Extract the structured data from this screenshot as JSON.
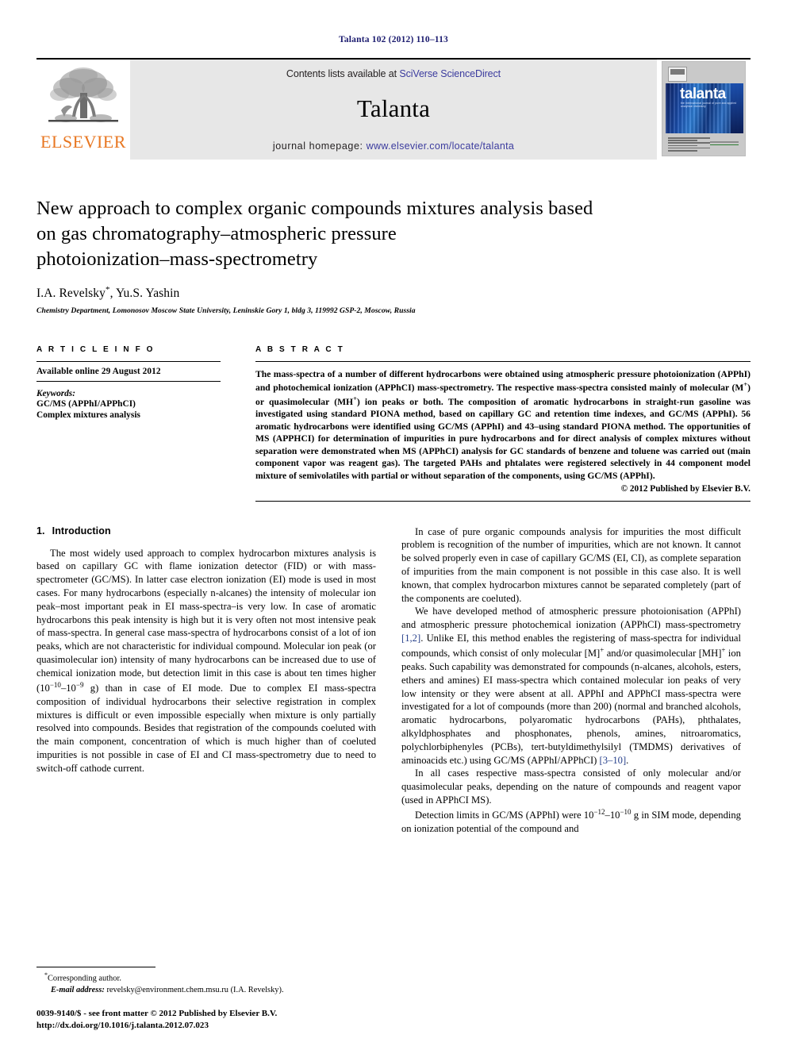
{
  "running_head": "Talanta 102 (2012) 110–113",
  "masthead": {
    "publisher_logo_label": "ELSEVIER",
    "contents_prefix": "Contents lists available at ",
    "contents_link": "SciVerse ScienceDirect",
    "journal_title": "Talanta",
    "homepage_prefix": "journal homepage: ",
    "homepage_link": "www.elsevier.com/locate/talanta",
    "cover_title": "talanta",
    "cover_subtitle": "the international journal of pure and applied analytical chemistry"
  },
  "article": {
    "title_line1": "New approach to complex organic compounds mixtures analysis based",
    "title_line2": "on gas chromatography–atmospheric pressure",
    "title_line3": "photoionization–mass-spectrometry",
    "authors": "I.A. Revelsky",
    "authors_star": "*",
    "authors_rest": ", Yu.S. Yashin",
    "affiliation": "Chemistry Department, Lomonosov Moscow State University, Leninskie Gory 1, bldg 3, 119992 GSP-2, Moscow, Russia"
  },
  "article_info": {
    "heading": "A R T I C L E  I N F O",
    "history": "Available online 29 August 2012",
    "keywords_label": "Keywords:",
    "keywords": [
      "GC/MS (APPhI/APPhCI)",
      "Complex mixtures analysis"
    ]
  },
  "abstract": {
    "heading": "A B S T R A C T",
    "p1_a": "The mass-spectra of a number of different hydrocarbons were obtained using atmospheric pressure photoionization (APPhI) and photochemical ionization (APPhCI) mass-spectrometry. The respective mass-spectra consisted mainly of molecular (M",
    "p1_sup1": "+",
    "p1_b": ") or quasimolecular (MH",
    "p1_sup2": "+",
    "p1_c": ") ion peaks or both. The composition of aromatic hydrocarbons in straight-run gasoline was investigated using standard PIONA method, based on capillary GC and retention time indexes, and GC/MS (APPhI). 56 aromatic hydrocarbons were identified using GC/MS (APPhI) and 43–using standard PIONA method. The opportunities of MS (APPHCI) for determination of impurities in pure hydrocarbons and for direct analysis of complex mixtures without separation were demonstrated when MS (APPhCI) analysis for GC standards of benzene and toluene was carried out (main component vapor was reagent gas). The targeted PAHs and phtalates were registered selectively in 44 component model mixture of semivolatiles with partial or without separation of the components, using GC/MS (APPhI).",
    "copyright": "© 2012 Published by Elsevier B.V."
  },
  "body": {
    "section1_number": "1.",
    "section1_title": "Introduction",
    "left_p1_a": "The most widely used approach to complex hydrocarbon mixtures analysis is based on capillary GC with flame ionization detector (FID) or with mass-spectrometer (GC/MS). In latter case electron ionization (EI) mode is used in most cases. For many hydrocarbons (especially n-alcanes) the intensity of molecular ion peak–most important peak in EI mass-spectra–is very low. In case of aromatic hydrocarbons this peak intensity is high but it is very often not most intensive peak of mass-spectra. In general case mass-spectra of hydrocarbons consist of a lot of ion peaks, which are not characteristic for individual compound. Molecular ion peak (or quasimolecular ion) intensity of many hydrocarbons can be increased due to use of chemical ionization mode, but detection limit in this case is about ten times higher (10",
    "left_p1_sup1": "−10",
    "left_p1_b": "–10",
    "left_p1_sup2": "−9",
    "left_p1_c": " g) than in case of EI mode. Due to complex EI mass-spectra composition of individual hydrocarbons their selective registration in complex mixtures is difficult or even impossible especially when mixture is only partially resolved into compounds. Besides that registration of the compounds coeluted with the main component, concentration of which is much higher than of coeluted impurities is not possible in case of EI and CI mass-spectrometry due to need to switch-off cathode current.",
    "right_p1": "In case of pure organic compounds analysis for impurities the most difficult problem is recognition of the number of impurities, which are not known. It cannot be solved properly even in case of capillary GC/MS (EI, CI), as complete separation of impurities from the main component is not possible in this case also. It is well known, that complex hydrocarbon mixtures cannot be separated completely (part of the components are coeluted).",
    "right_p2_a": "We have developed method of atmospheric pressure photoionisation (APPhI) and atmospheric pressure photochemical ionization (APPhCI) mass-spectrometry ",
    "right_p2_cite1": "[1,2]",
    "right_p2_b": ". Unlike EI, this method enables the registering of mass-spectra for individual compounds, which consist of only molecular [M]",
    "right_p2_sup1": "+",
    "right_p2_c": " and/or quasimolecular [MH]",
    "right_p2_sup2": "+",
    "right_p2_d": " ion peaks. Such capability was demonstrated for compounds (n-alcanes, alcohols, esters, ethers and amines) EI mass-spectra which contained molecular ion peaks of very low intensity or they were absent at all. APPhI and APPhCI mass-spectra were investigated for a lot of compounds (more than 200) (normal and branched alcohols, aromatic hydrocarbons, polyaromatic hydrocarbons (PAHs), phthalates, alkyldphosphates and phosphonates, phenols, amines, nitroaromatics, polychlorbiphenyles (PCBs), tert-butyldimethylsilyl (TMDMS) derivatives of aminoacids etc.) using GC/MS (APPhI/APPhCI) ",
    "right_p2_cite2": "[3–10]",
    "right_p2_e": ".",
    "right_p3": "In all cases respective mass-spectra consisted of only molecular and/or quasimolecular peaks, depending on the nature of compounds and reagent vapor (used in APPhCI MS).",
    "right_p4_a": "Detection limits in GC/MS (APPhI) were 10",
    "right_p4_sup1": "−12",
    "right_p4_b": "–10",
    "right_p4_sup2": "−10",
    "right_p4_c": " g in SIM mode, depending on ionization potential of the compound and"
  },
  "footnote": {
    "star": "*",
    "corresponding": "Corresponding author.",
    "email_label": "E-mail address:",
    "email": " revelsky@environment.chem.msu.ru (I.A. Revelsky).",
    "issn_line": "0039-9140/$ - see front matter © 2012 Published by Elsevier B.V.",
    "doi_line": "http://dx.doi.org/10.1016/j.talanta.2012.07.023"
  }
}
